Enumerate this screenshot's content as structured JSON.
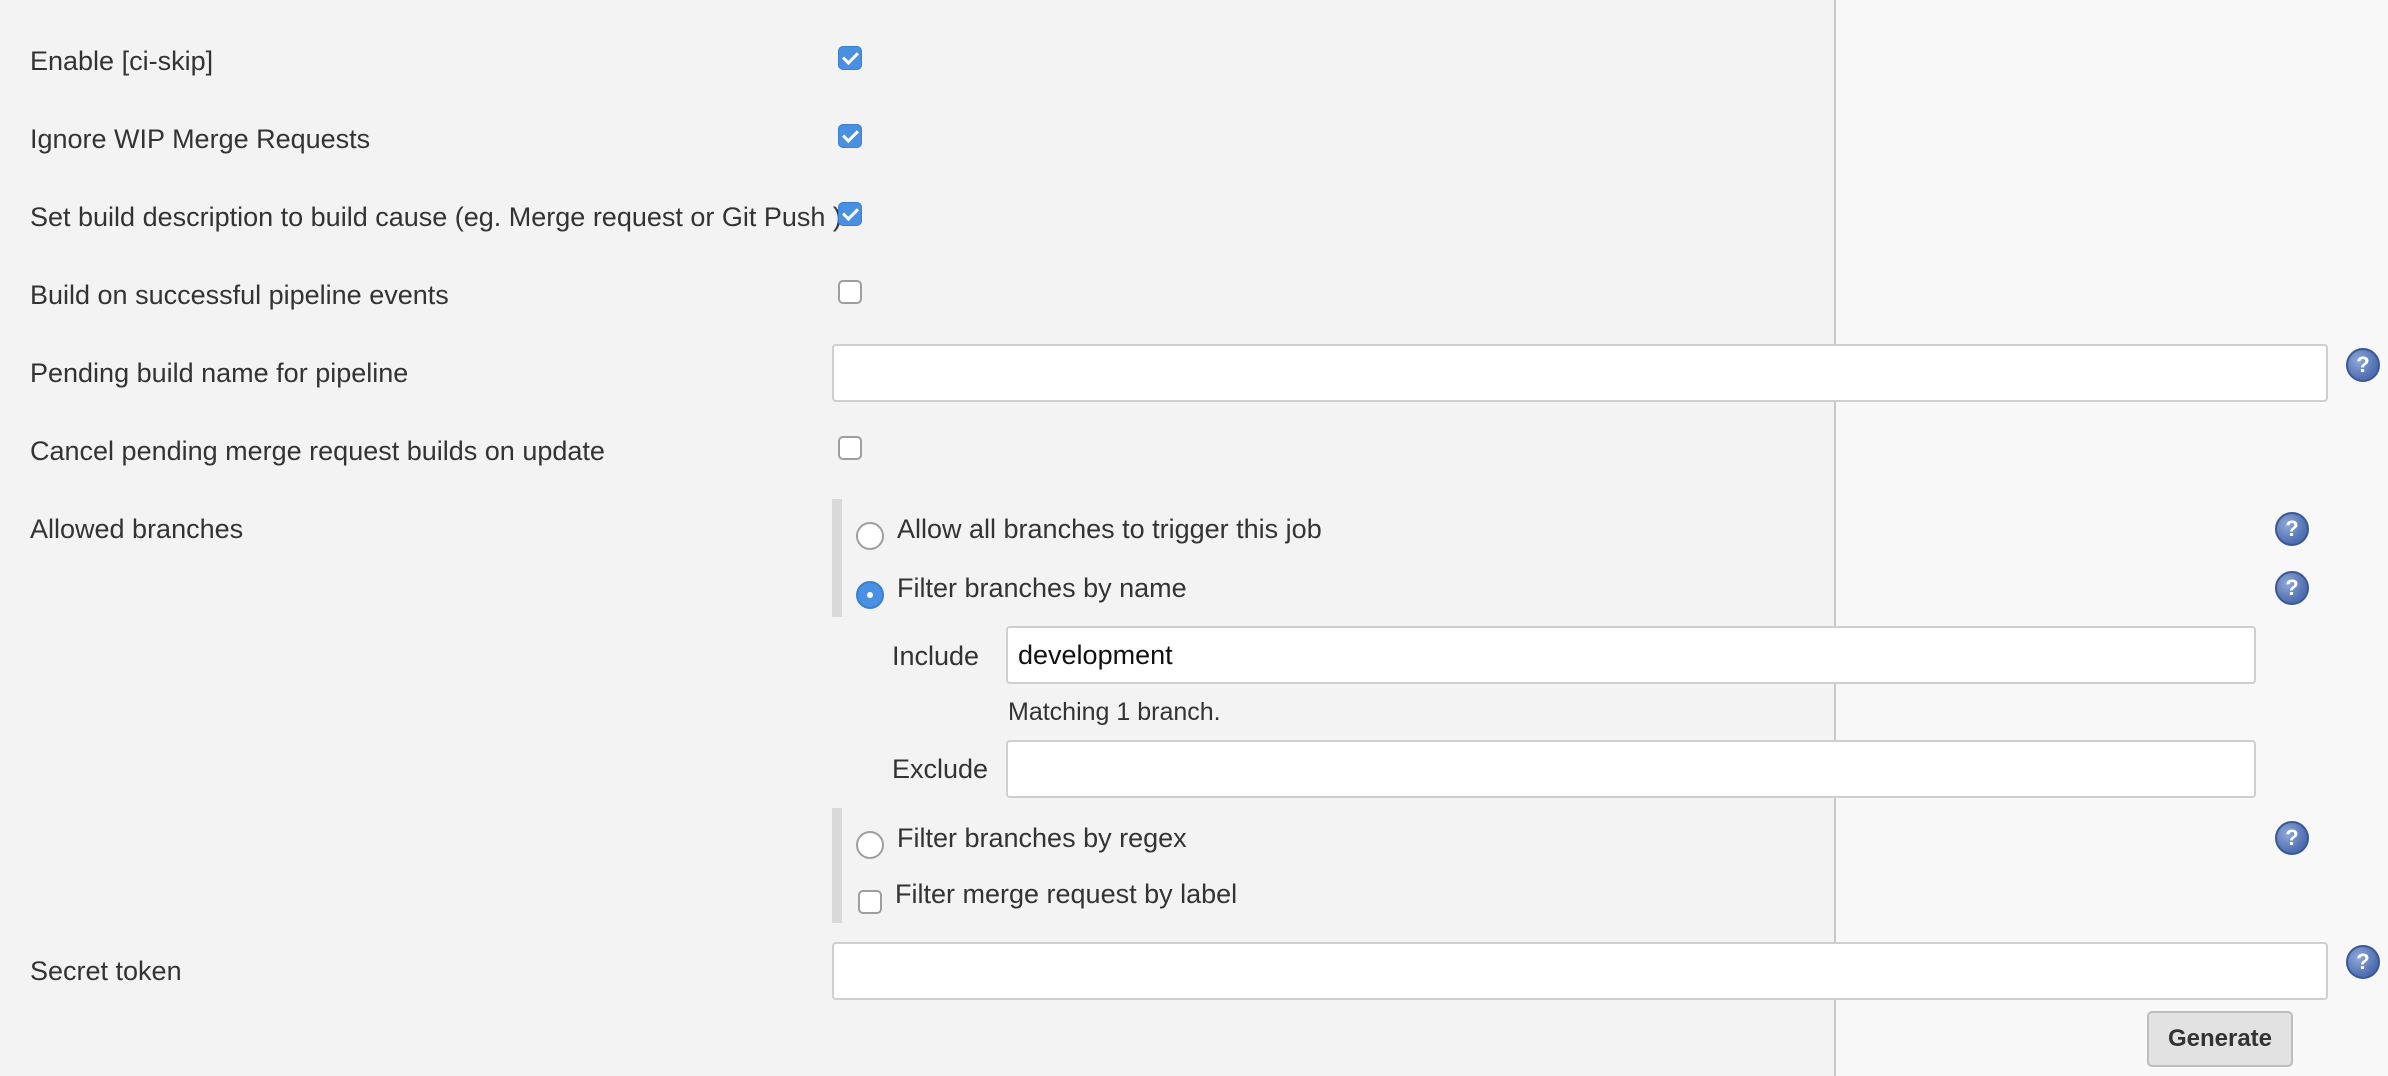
{
  "options": {
    "ci_skip": {
      "label": "Enable [ci-skip]",
      "checked": true
    },
    "ignore_wip": {
      "label": "Ignore WIP Merge Requests",
      "checked": true
    },
    "set_build_description": {
      "label": "Set build description to build cause (eg. Merge request or Git Push )",
      "checked": true
    },
    "build_on_pipeline": {
      "label": "Build on successful pipeline events",
      "checked": false
    },
    "pending_build_name": {
      "label": "Pending build name for pipeline",
      "value": ""
    },
    "cancel_pending": {
      "label": "Cancel pending merge request builds on update",
      "checked": false
    }
  },
  "allowed_branches": {
    "label": "Allowed branches",
    "all": "Allow all branches to trigger this job",
    "by_name": "Filter branches by name",
    "include_label": "Include",
    "include_value": "development",
    "matching_note": "Matching 1 branch.",
    "exclude_label": "Exclude",
    "exclude_value": "",
    "by_regex": "Filter branches by regex",
    "by_label": "Filter merge request by label",
    "selected": "by_name"
  },
  "secret_token": {
    "label": "Secret token",
    "value": ""
  },
  "generate_button": "Generate",
  "help_icon_glyph": "?",
  "colors": {
    "accent": "#4a90e2",
    "background": "#f3f3f3",
    "help": "#4d6db0"
  }
}
